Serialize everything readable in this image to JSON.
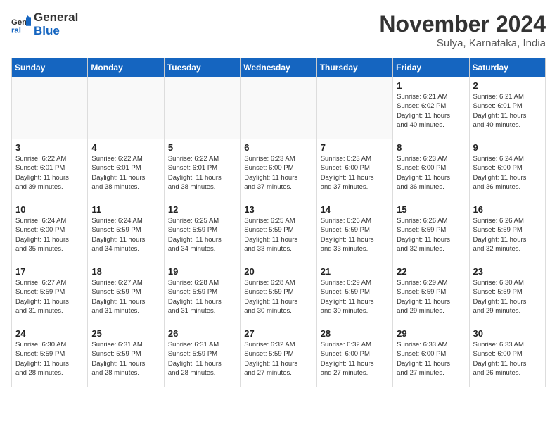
{
  "logo": {
    "line1": "General",
    "line2": "Blue"
  },
  "title": "November 2024",
  "location": "Sulya, Karnataka, India",
  "weekdays": [
    "Sunday",
    "Monday",
    "Tuesday",
    "Wednesday",
    "Thursday",
    "Friday",
    "Saturday"
  ],
  "weeks": [
    [
      {
        "day": "",
        "info": "",
        "empty": true
      },
      {
        "day": "",
        "info": "",
        "empty": true
      },
      {
        "day": "",
        "info": "",
        "empty": true
      },
      {
        "day": "",
        "info": "",
        "empty": true
      },
      {
        "day": "",
        "info": "",
        "empty": true
      },
      {
        "day": "1",
        "info": "Sunrise: 6:21 AM\nSunset: 6:02 PM\nDaylight: 11 hours\nand 40 minutes."
      },
      {
        "day": "2",
        "info": "Sunrise: 6:21 AM\nSunset: 6:01 PM\nDaylight: 11 hours\nand 40 minutes."
      }
    ],
    [
      {
        "day": "3",
        "info": "Sunrise: 6:22 AM\nSunset: 6:01 PM\nDaylight: 11 hours\nand 39 minutes."
      },
      {
        "day": "4",
        "info": "Sunrise: 6:22 AM\nSunset: 6:01 PM\nDaylight: 11 hours\nand 38 minutes."
      },
      {
        "day": "5",
        "info": "Sunrise: 6:22 AM\nSunset: 6:01 PM\nDaylight: 11 hours\nand 38 minutes."
      },
      {
        "day": "6",
        "info": "Sunrise: 6:23 AM\nSunset: 6:00 PM\nDaylight: 11 hours\nand 37 minutes."
      },
      {
        "day": "7",
        "info": "Sunrise: 6:23 AM\nSunset: 6:00 PM\nDaylight: 11 hours\nand 37 minutes."
      },
      {
        "day": "8",
        "info": "Sunrise: 6:23 AM\nSunset: 6:00 PM\nDaylight: 11 hours\nand 36 minutes."
      },
      {
        "day": "9",
        "info": "Sunrise: 6:24 AM\nSunset: 6:00 PM\nDaylight: 11 hours\nand 36 minutes."
      }
    ],
    [
      {
        "day": "10",
        "info": "Sunrise: 6:24 AM\nSunset: 6:00 PM\nDaylight: 11 hours\nand 35 minutes."
      },
      {
        "day": "11",
        "info": "Sunrise: 6:24 AM\nSunset: 5:59 PM\nDaylight: 11 hours\nand 34 minutes."
      },
      {
        "day": "12",
        "info": "Sunrise: 6:25 AM\nSunset: 5:59 PM\nDaylight: 11 hours\nand 34 minutes."
      },
      {
        "day": "13",
        "info": "Sunrise: 6:25 AM\nSunset: 5:59 PM\nDaylight: 11 hours\nand 33 minutes."
      },
      {
        "day": "14",
        "info": "Sunrise: 6:26 AM\nSunset: 5:59 PM\nDaylight: 11 hours\nand 33 minutes."
      },
      {
        "day": "15",
        "info": "Sunrise: 6:26 AM\nSunset: 5:59 PM\nDaylight: 11 hours\nand 32 minutes."
      },
      {
        "day": "16",
        "info": "Sunrise: 6:26 AM\nSunset: 5:59 PM\nDaylight: 11 hours\nand 32 minutes."
      }
    ],
    [
      {
        "day": "17",
        "info": "Sunrise: 6:27 AM\nSunset: 5:59 PM\nDaylight: 11 hours\nand 31 minutes."
      },
      {
        "day": "18",
        "info": "Sunrise: 6:27 AM\nSunset: 5:59 PM\nDaylight: 11 hours\nand 31 minutes."
      },
      {
        "day": "19",
        "info": "Sunrise: 6:28 AM\nSunset: 5:59 PM\nDaylight: 11 hours\nand 31 minutes."
      },
      {
        "day": "20",
        "info": "Sunrise: 6:28 AM\nSunset: 5:59 PM\nDaylight: 11 hours\nand 30 minutes."
      },
      {
        "day": "21",
        "info": "Sunrise: 6:29 AM\nSunset: 5:59 PM\nDaylight: 11 hours\nand 30 minutes."
      },
      {
        "day": "22",
        "info": "Sunrise: 6:29 AM\nSunset: 5:59 PM\nDaylight: 11 hours\nand 29 minutes."
      },
      {
        "day": "23",
        "info": "Sunrise: 6:30 AM\nSunset: 5:59 PM\nDaylight: 11 hours\nand 29 minutes."
      }
    ],
    [
      {
        "day": "24",
        "info": "Sunrise: 6:30 AM\nSunset: 5:59 PM\nDaylight: 11 hours\nand 28 minutes."
      },
      {
        "day": "25",
        "info": "Sunrise: 6:31 AM\nSunset: 5:59 PM\nDaylight: 11 hours\nand 28 minutes."
      },
      {
        "day": "26",
        "info": "Sunrise: 6:31 AM\nSunset: 5:59 PM\nDaylight: 11 hours\nand 28 minutes."
      },
      {
        "day": "27",
        "info": "Sunrise: 6:32 AM\nSunset: 5:59 PM\nDaylight: 11 hours\nand 27 minutes."
      },
      {
        "day": "28",
        "info": "Sunrise: 6:32 AM\nSunset: 6:00 PM\nDaylight: 11 hours\nand 27 minutes."
      },
      {
        "day": "29",
        "info": "Sunrise: 6:33 AM\nSunset: 6:00 PM\nDaylight: 11 hours\nand 27 minutes."
      },
      {
        "day": "30",
        "info": "Sunrise: 6:33 AM\nSunset: 6:00 PM\nDaylight: 11 hours\nand 26 minutes."
      }
    ]
  ]
}
